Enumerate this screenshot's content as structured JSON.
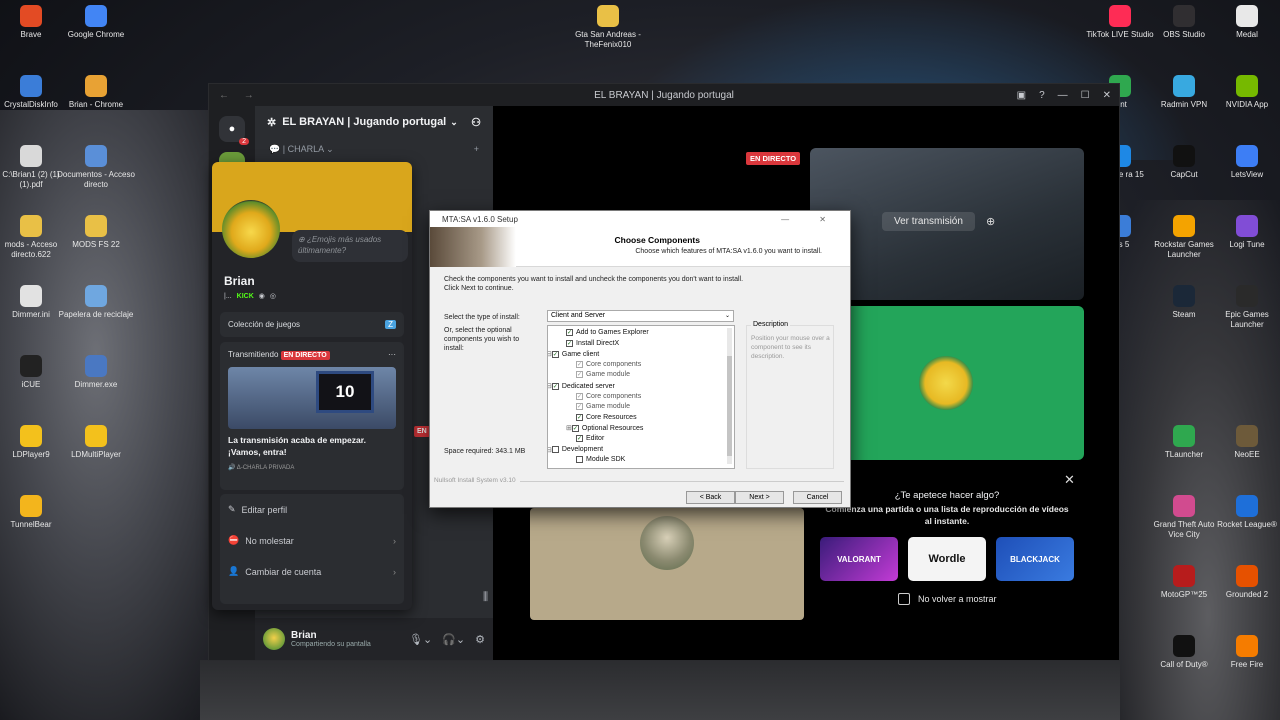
{
  "desktop": {
    "left_icons": [
      {
        "label": "Brave",
        "color": "#e34b24"
      },
      {
        "label": "Google Chrome",
        "color": "#4285f4"
      },
      {
        "label": "CrystalDiskInfo",
        "color": "#3b7dd8"
      },
      {
        "label": "Brian - Chrome",
        "color": "#e8a234"
      },
      {
        "label": "C:\\Brian1 (2) (1) (1).pdf",
        "color": "#d9d9d9"
      },
      {
        "label": "Documentos - Acceso directo",
        "color": "#5a8fd8"
      },
      {
        "label": "mods - Acceso directo.622",
        "color": "#e9c046"
      },
      {
        "label": "MODS FS 22",
        "color": "#e9c046"
      },
      {
        "label": "Dimmer.ini",
        "color": "#e2e2e2"
      },
      {
        "label": "Papelera de reciclaje",
        "color": "#6fa7e0"
      },
      {
        "label": "iCUE",
        "color": "#222222"
      },
      {
        "label": "Dimmer.exe",
        "color": "#4a78c2"
      },
      {
        "label": "LDPlayer9",
        "color": "#f3c11c"
      },
      {
        "label": "LDMultiPlayer",
        "color": "#f3c11c"
      },
      {
        "label": "TunnelBear",
        "color": "#f3b51c"
      }
    ],
    "top_icons": [
      {
        "label": "Gta San Andreas - TheFenix010",
        "color": "#e9c046"
      }
    ],
    "right_icons": [
      {
        "label": "TikTok LIVE Studio",
        "color": "#fe2c55"
      },
      {
        "label": "OBS Studio",
        "color": "#302e31"
      },
      {
        "label": "Medal",
        "color": "#e8e8e8"
      },
      {
        "label": "rent",
        "color": "#2fa84f"
      },
      {
        "label": "Radmin VPN",
        "color": "#38a9e0"
      },
      {
        "label": "NVIDIA App",
        "color": "#76b900"
      },
      {
        "label": "ershare ra 15",
        "color": "#1e88e5"
      },
      {
        "label": "CapCut",
        "color": "#111111"
      },
      {
        "label": "LetsView",
        "color": "#3d7ef5"
      },
      {
        "label": "cks 5",
        "color": "#3b7dd8"
      },
      {
        "label": "Rockstar Games Launcher",
        "color": "#f4a300"
      },
      {
        "label": "Logi Tune",
        "color": "#814dd6"
      },
      {
        "label": "Steam",
        "color": "#1b2838"
      },
      {
        "label": "Epic Games Launcher",
        "color": "#2a2a2a"
      },
      {
        "label": "TLauncher",
        "color": "#2fa84f"
      },
      {
        "label": "NeoEE",
        "color": "#6d5a3a"
      },
      {
        "label": "Grand Theft Auto Vice City",
        "color": "#d14b8f"
      },
      {
        "label": "Rocket League®",
        "color": "#1e6fd9"
      },
      {
        "label": "MotoGP™25",
        "color": "#b71c1c"
      },
      {
        "label": "Grounded 2",
        "color": "#e65100"
      },
      {
        "label": "Call of Duty®",
        "color": "#111111"
      },
      {
        "label": "Free Fire",
        "color": "#f57c00"
      }
    ]
  },
  "discord": {
    "window_title": "EL BRAYAN | Jugando portugal",
    "nav": "← →",
    "server_name": "EL BRAYAN | Jugando portugal",
    "channel": "| CHARLA",
    "guild_badge": "2",
    "user": {
      "name": "Brian",
      "status": "Compartiendo su pantalla"
    },
    "live_label": "EN DIRECTO",
    "watch_stream": "Ver transmisión",
    "activity": {
      "title": "¿Te apetece hacer algo?",
      "subtitle": "Comienza una partida o una lista de reproducción de vídeos al instante.",
      "games": [
        "VALORANT",
        "Wordle",
        "BLACKJACK"
      ],
      "dont_show": "No volver a mostrar"
    }
  },
  "profile": {
    "name": "Brian",
    "tag": "|...",
    "kick_label": "KICK",
    "emoji_hint": "¿Emojis más usados últimamente?",
    "games_collection": "Colección de juegos",
    "streaming_label": "Transmitiendo",
    "live_label": "EN DIRECTO",
    "tv_number": "10",
    "stream_message": "La transmisión acaba de empezar. ¡Vamos, entra!",
    "channel_line": "🔊 Δ-CHARLA PRIVADA",
    "menu": [
      {
        "label": "Editar perfil",
        "icon": "✎"
      },
      {
        "label": "No molestar",
        "icon": "⛔"
      },
      {
        "label": "Cambiar de cuenta",
        "icon": "👤"
      }
    ]
  },
  "installer": {
    "window_title": "MTA:SA v1.6.0 Setup",
    "heading": "Choose Components",
    "subheading": "Choose which features of MTA:SA v1.6.0 you want to install.",
    "instructions": "Check the components you want to install and uncheck the components you don't want to install. Click Next to continue.",
    "install_type_label": "Select the type of install:",
    "install_type_value": "Client and Server",
    "optional_label": "Or, select the optional components you wish to install:",
    "space_required": "Space required: 343.1 MB",
    "components": [
      {
        "label": "Add to Games Explorer",
        "checked": true,
        "dim": false
      },
      {
        "label": "Install DirectX",
        "checked": true,
        "dim": false
      },
      {
        "label": "Game client",
        "checked": true,
        "dim": false
      },
      {
        "label": "Core components",
        "checked": true,
        "dim": true
      },
      {
        "label": "Game module",
        "checked": true,
        "dim": true
      },
      {
        "label": "Dedicated server",
        "checked": true,
        "dim": false
      },
      {
        "label": "Core components",
        "checked": true,
        "dim": true
      },
      {
        "label": "Game module",
        "checked": true,
        "dim": true
      },
      {
        "label": "Core Resources",
        "checked": true,
        "dim": false
      },
      {
        "label": "Optional Resources",
        "checked": true,
        "dim": false
      },
      {
        "label": "Editor",
        "checked": true,
        "dim": false
      },
      {
        "label": "Development",
        "checked": false,
        "dim": false
      },
      {
        "label": "Module SDK",
        "checked": false,
        "dim": false
      }
    ],
    "description_title": "Description",
    "description_text": "Position your mouse over a component to see its description.",
    "nsis": "Nullsoft Install System v3.10",
    "buttons": {
      "back": "< Back",
      "next": "Next >",
      "cancel": "Cancel"
    }
  }
}
